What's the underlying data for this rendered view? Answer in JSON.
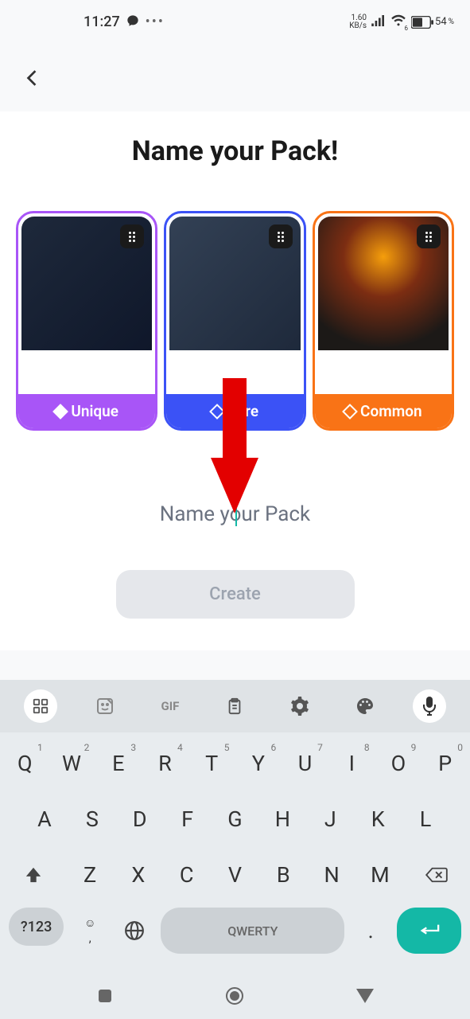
{
  "status": {
    "time": "11:27",
    "kbs_top": "1.60",
    "kbs_bottom": "KB/s",
    "wifi_sub": "6",
    "battery": "54",
    "battery_suffix": "%"
  },
  "header": {
    "title": "Name your Pack!"
  },
  "cards": [
    {
      "rarity": "Unique"
    },
    {
      "rarity": "Rare"
    },
    {
      "rarity": "Common"
    }
  ],
  "input": {
    "placeholder": "Name your Pack",
    "value": ""
  },
  "create_button": "Create",
  "keyboard": {
    "toolbar_gif": "GIF",
    "row1": [
      {
        "k": "Q",
        "n": "1"
      },
      {
        "k": "W",
        "n": "2"
      },
      {
        "k": "E",
        "n": "3"
      },
      {
        "k": "R",
        "n": "4"
      },
      {
        "k": "T",
        "n": "5"
      },
      {
        "k": "Y",
        "n": "6"
      },
      {
        "k": "U",
        "n": "7"
      },
      {
        "k": "I",
        "n": "8"
      },
      {
        "k": "O",
        "n": "9"
      },
      {
        "k": "P",
        "n": "0"
      }
    ],
    "row2": [
      "A",
      "S",
      "D",
      "F",
      "G",
      "H",
      "J",
      "K",
      "L"
    ],
    "row3": [
      "Z",
      "X",
      "C",
      "V",
      "B",
      "N",
      "M"
    ],
    "sym_key": "?123",
    "comma": ",",
    "space": "QWERTY",
    "dot": "."
  }
}
